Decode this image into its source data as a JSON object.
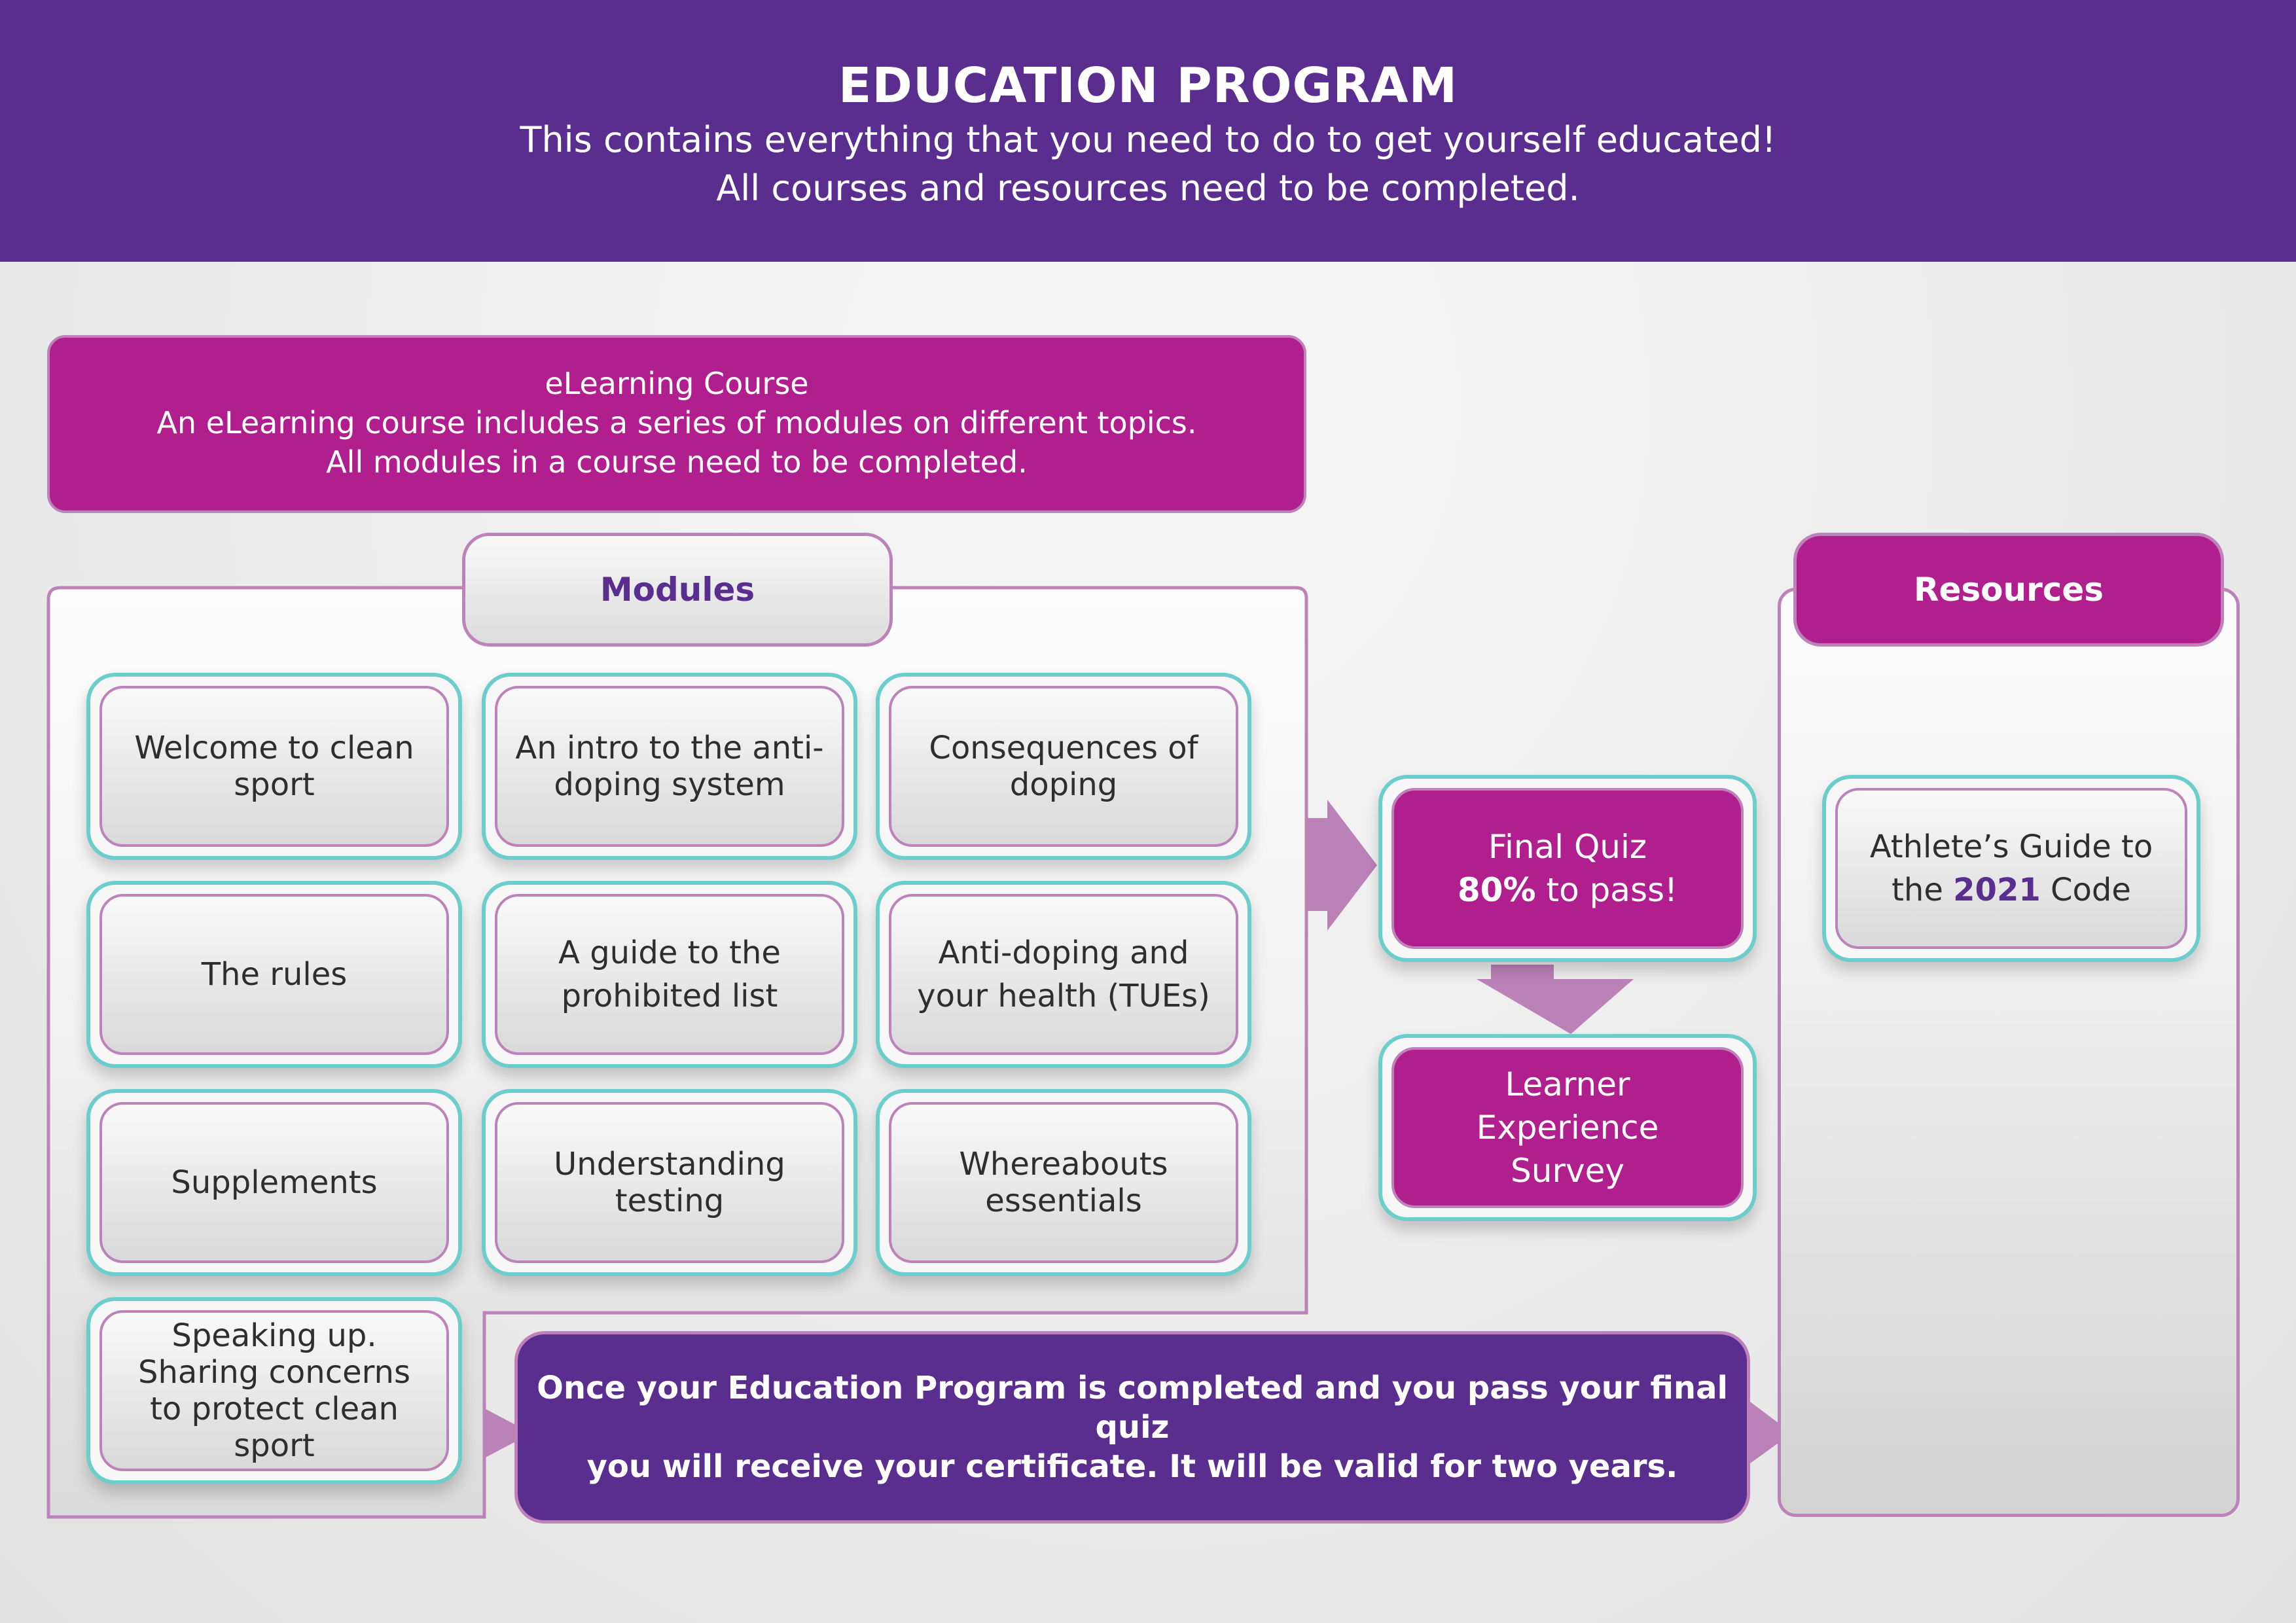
{
  "header": {
    "title": "EDUCATION PROGRAM",
    "subtitle_line1": "This contains everything that you need to do to get yourself educated!",
    "subtitle_line2": "All courses and resources need to be completed."
  },
  "course": {
    "title": "eLearning Course",
    "line1": "An eLearning course includes a series of modules on different topics.",
    "line2": "All modules in a course need to be completed."
  },
  "modules": {
    "label": "Modules",
    "items": [
      "Welcome to clean sport",
      "An intro to the anti-doping system",
      "Consequences of doping",
      "The rules",
      "A guide to the prohibited list",
      "Anti-doping and your health (TUEs)",
      "Supplements",
      "Understanding testing",
      "Whereabouts essentials",
      "Speaking up. Sharing concerns to protect clean sport"
    ]
  },
  "quiz": {
    "title": "Final Quiz",
    "pass_value": "80%",
    "pass_suffix": " to pass!"
  },
  "survey": {
    "label": "Learner Experience Survey"
  },
  "resources": {
    "label": "Resources",
    "item_prefix": "Athlete’s Guide to the ",
    "item_year": "2021",
    "item_suffix": " Code"
  },
  "certificate": {
    "line1": "Once your Education Program is completed and you pass your final quiz",
    "line2": "you will receive your certificate. It will be valid for two years."
  },
  "colors": {
    "header_purple": "#5a2e8e",
    "magenta": "#b01f8d",
    "lilac_border": "#bd82ba",
    "teal_border": "#6bcdcc"
  }
}
